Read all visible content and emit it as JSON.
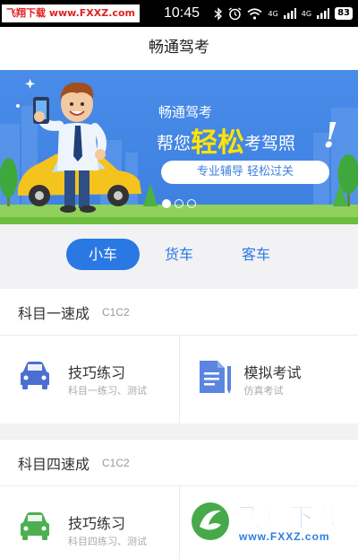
{
  "status_bar": {
    "watermark": "飞翔下载 www.FXXZ.com",
    "time": "10:45",
    "signal_1": "4G",
    "signal_2": "4G",
    "battery": "83"
  },
  "header": {
    "title": "畅通驾考"
  },
  "banner": {
    "brand": "畅通驾考",
    "slogan_prefix": "帮您",
    "slogan_highlight": "轻松",
    "slogan_suffix": "考驾照",
    "exclamation": "!",
    "pill_text": "专业辅导   轻松过关",
    "slides": 3,
    "active_slide": 1
  },
  "tabs": [
    {
      "label": "小车",
      "active": true
    },
    {
      "label": "货车",
      "active": false
    },
    {
      "label": "客车",
      "active": false
    }
  ],
  "sections": [
    {
      "title": "科目一速成",
      "subtitle": "C1C2",
      "cards": [
        {
          "title": "技巧练习",
          "subtitle": "科目一练习、测试",
          "icon": "car-icon",
          "color": "#4a6fd1"
        },
        {
          "title": "模拟考试",
          "subtitle": "仿真考试",
          "icon": "document-pen-icon",
          "color": "#5a86e0"
        }
      ]
    },
    {
      "title": "科目四速成",
      "subtitle": "C1C2",
      "cards": [
        {
          "title": "技巧练习",
          "subtitle": "科目四练习、测试",
          "icon": "car-icon",
          "color": "#4caf50"
        }
      ]
    }
  ],
  "watermark_bottom": {
    "name": "飞翔下载",
    "url": "www.FXXZ.com"
  },
  "colors": {
    "accent": "#2a78e4",
    "banner": "#3d7fe0",
    "highlight": "#ffe400"
  }
}
